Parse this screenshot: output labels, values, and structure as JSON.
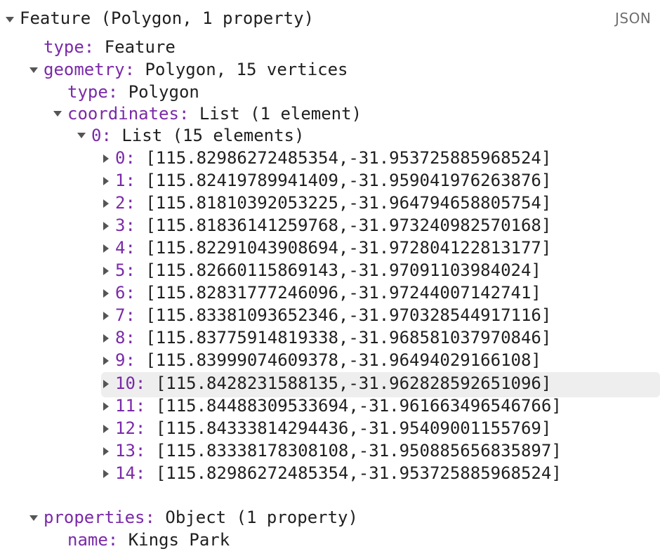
{
  "badge": "JSON",
  "root": {
    "label": "Feature (Polygon, 1 property)"
  },
  "type_key": "type:",
  "type_value": "Feature",
  "geometry": {
    "key": "geometry:",
    "summary": "Polygon, 15 vertices",
    "type_key": "type:",
    "type_value": "Polygon",
    "coordinates": {
      "key": "coordinates:",
      "summary": "List (1 element)",
      "ring": {
        "key": "0:",
        "summary": "List (15 elements)",
        "items": [
          {
            "key": "0:",
            "value": "[115.82986272485354,-31.953725885968524]"
          },
          {
            "key": "1:",
            "value": "[115.82419789941409,-31.959041976263876]"
          },
          {
            "key": "2:",
            "value": "[115.81810392053225,-31.964794658805754]"
          },
          {
            "key": "3:",
            "value": "[115.81836141259768,-31.973240982570168]"
          },
          {
            "key": "4:",
            "value": "[115.82291043908694,-31.972804122813177]"
          },
          {
            "key": "5:",
            "value": "[115.82660115869143,-31.97091103984024]"
          },
          {
            "key": "6:",
            "value": "[115.82831777246096,-31.97244007142741]"
          },
          {
            "key": "7:",
            "value": "[115.83381093652346,-31.970328544917116]"
          },
          {
            "key": "8:",
            "value": "[115.83775914819338,-31.968581037970846]"
          },
          {
            "key": "9:",
            "value": "[115.83999074609378,-31.9649402916610 8]"
          },
          {
            "key": "10:",
            "value": "[115.8428231588135,-31.962828592651096]"
          },
          {
            "key": "11:",
            "value": "[115.84488309533694,-31.961663496546766]"
          },
          {
            "key": "12:",
            "value": "[115.84333814294436,-31.95409001155769]"
          },
          {
            "key": "13:",
            "value": "[115.83338178308108,-31.950885656835897]"
          },
          {
            "key": "14:",
            "value": "[115.82986272485354,-31.953725885968524]"
          }
        ]
      }
    }
  },
  "properties": {
    "key": "properties:",
    "summary": "Object (1 property)",
    "name_key": "name:",
    "name_value": "Kings Park"
  }
}
